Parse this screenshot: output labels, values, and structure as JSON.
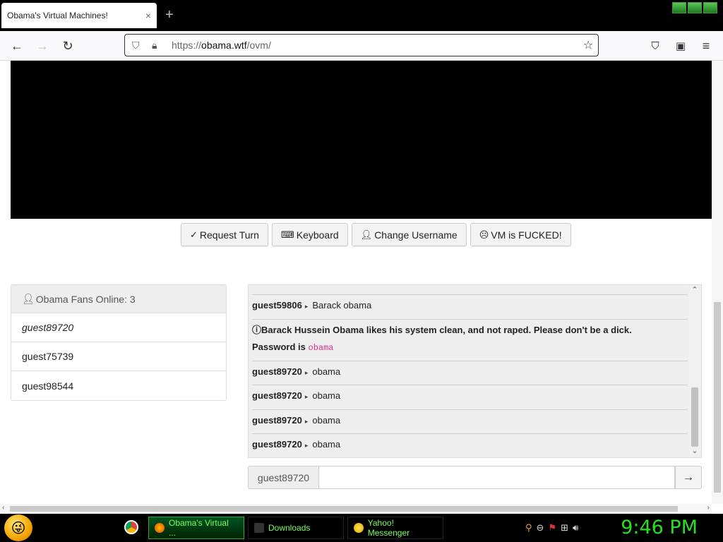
{
  "browser": {
    "tab_title": "Obama's Virtual Machines!",
    "tab_close": "×",
    "new_tab": "+",
    "url_prefix": "https://",
    "url_host": "obama.wtf",
    "url_path": "/ovm/"
  },
  "buttons": {
    "request_turn": "Request Turn",
    "keyboard": "Keyboard",
    "change_username": "Change Username",
    "vm_fucked": "VM is FUCKED!"
  },
  "users": {
    "header": "Obama Fans Online: 3",
    "list": [
      "guest89720",
      "guest75739",
      "guest98544"
    ]
  },
  "chat": {
    "messages": [
      {
        "user": "guest59806",
        "text": "Barack obama"
      },
      {
        "system": "Barack Hussein Obama likes his system clean, and not raped. Please don't be a dick.",
        "password_label": "Password is",
        "password": "obama"
      },
      {
        "user": "guest89720",
        "text": "obama"
      },
      {
        "user": "guest89720",
        "text": "obama"
      },
      {
        "user": "guest89720",
        "text": "obama"
      },
      {
        "user": "guest89720",
        "text": "obama"
      }
    ],
    "input_prefix": "guest89720",
    "input_value": "",
    "send_symbol": "→"
  },
  "taskbar": {
    "items": [
      {
        "label": "Obama's Virtual ...",
        "active": true
      },
      {
        "label": "Downloads",
        "active": false
      },
      {
        "label": "Yahoo! Messenger",
        "active": false
      }
    ],
    "clock": "9:46 PM"
  }
}
